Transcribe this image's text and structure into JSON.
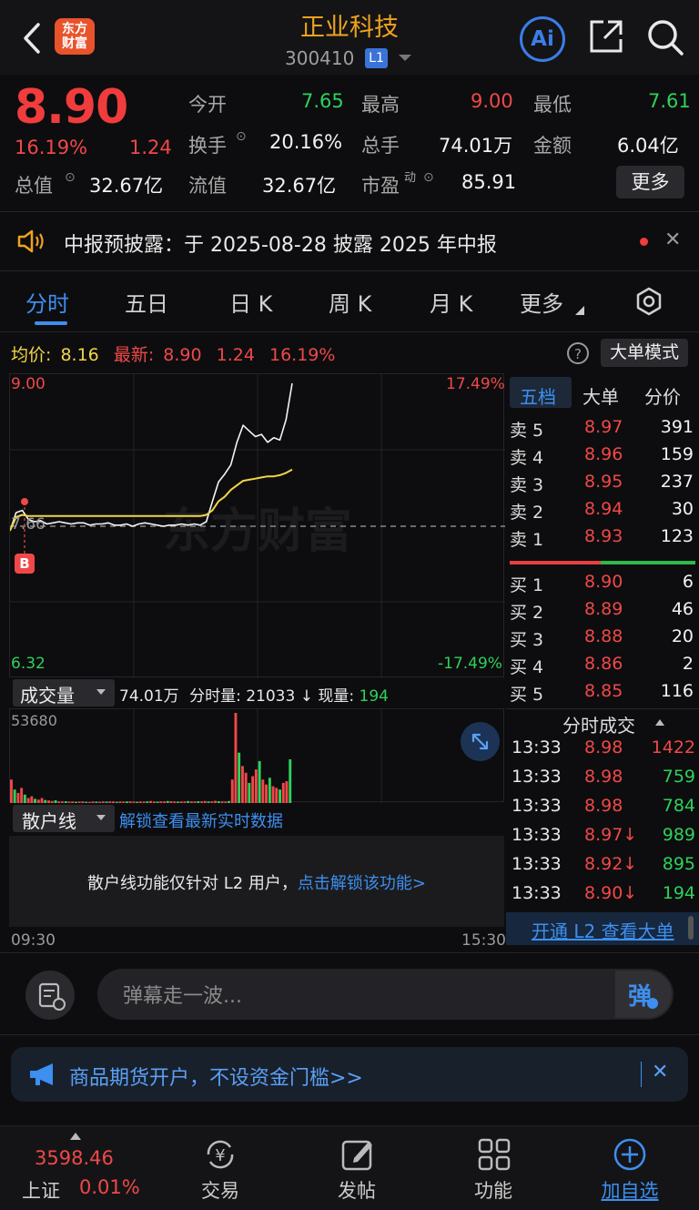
{
  "header": {
    "back_icon": "chevron-left-icon",
    "logo_text_1": "东方",
    "logo_text_2": "财富",
    "title": "正业科技",
    "code": "300410",
    "level_badge": "L1",
    "ai_label": "Ai"
  },
  "quote": {
    "price": "8.90",
    "change_pct": "16.19%",
    "change_amt": "1.24",
    "open_label": "今开",
    "open": "7.65",
    "high_label": "最高",
    "high": "9.00",
    "low_label": "最低",
    "low": "7.61",
    "turnover_label": "换手",
    "turnover": "20.16%",
    "volume_label": "总手",
    "volume": "74.01万",
    "amount_label": "金额",
    "amount": "6.04亿",
    "mktcap_label": "总值",
    "mktcap": "32.67亿",
    "float_label": "流值",
    "float_cap": "32.67亿",
    "pe_label": "市盈",
    "pe_sup": "动",
    "pe": "85.91",
    "more_button": "更多"
  },
  "notice": {
    "text": "中报预披露：于 2025-08-28 披露 2025 年中报"
  },
  "tabs": [
    "分时",
    "五日",
    "日 K",
    "周 K",
    "月 K",
    "更多"
  ],
  "chart_info": {
    "avg_label": "均价:",
    "avg": "8.16",
    "latest_label": "最新:",
    "latest": "8.90",
    "latest_chg": "1.24",
    "latest_pct": "16.19%",
    "mode_button": "大单模式"
  },
  "chart_data": {
    "type": "line",
    "title": "",
    "y_labels": {
      "top": "9.00",
      "mid": "7.66",
      "bottom": "6.32"
    },
    "pct_labels": {
      "top": "17.49%",
      "bottom": "-17.49%"
    },
    "ylim": [
      6.32,
      9.0
    ],
    "baseline": 7.66,
    "x_labels": [
      "09:30",
      "15:30"
    ],
    "marker_label": "B",
    "watermark": "东方财富",
    "series": [
      {
        "values": [
          7.62,
          7.78,
          7.8,
          7.72,
          7.7,
          7.71,
          7.68,
          7.69,
          7.7,
          7.69,
          7.68,
          7.69,
          7.69,
          7.67,
          7.68,
          7.68,
          7.69,
          7.67,
          7.67,
          7.68,
          7.66,
          7.68,
          7.69,
          7.68,
          7.67,
          7.66,
          7.67,
          7.67,
          7.68,
          7.67,
          7.68,
          7.67,
          7.7,
          7.88,
          8.05,
          8.12,
          8.2,
          8.4,
          8.55,
          8.5,
          8.45,
          8.47,
          8.4,
          8.44,
          8.42,
          8.6,
          8.92
        ]
      },
      {
        "values": [
          7.62,
          7.74,
          7.76,
          7.75,
          7.75,
          7.75,
          7.75,
          7.75,
          7.75,
          7.75,
          7.75,
          7.75,
          7.75,
          7.75,
          7.75,
          7.75,
          7.75,
          7.75,
          7.75,
          7.75,
          7.75,
          7.75,
          7.75,
          7.75,
          7.75,
          7.75,
          7.75,
          7.75,
          7.75,
          7.75,
          7.75,
          7.75,
          7.76,
          7.8,
          7.88,
          7.92,
          7.98,
          8.02,
          8.06,
          8.07,
          8.08,
          8.09,
          8.1,
          8.1,
          8.11,
          8.13,
          8.16
        ]
      }
    ]
  },
  "volume": {
    "selector": "成交量",
    "total": "74.01万",
    "period_label": "分时量:",
    "period": "21033",
    "now_label": "现量:",
    "now": "194",
    "max_label": "53680"
  },
  "volume_data": {
    "type": "bar",
    "max": 53680,
    "values": [
      14000,
      8000,
      6000,
      9000,
      5000,
      3000,
      4000,
      2500,
      2000,
      3000,
      1800,
      1500,
      1200,
      1600,
      1000,
      900,
      1100,
      800,
      900,
      700,
      800,
      900,
      700,
      600,
      900,
      800,
      700,
      900,
      800,
      1000,
      900,
      700,
      900,
      800,
      900,
      1000,
      800,
      700,
      900,
      800,
      1000,
      1200,
      900,
      800,
      1000,
      900,
      1200,
      1100,
      900,
      800,
      1000,
      900,
      1200,
      1000,
      900,
      1100,
      1000,
      1200,
      900,
      1000,
      1300,
      1100,
      1000,
      900,
      1200,
      14000,
      53680,
      30000,
      22000,
      18000,
      12000,
      16000,
      20000,
      25000,
      14000,
      11000,
      15000,
      10000,
      9000,
      8000,
      12000,
      13000,
      26000
    ]
  },
  "retail": {
    "selector": "散户线",
    "unlock_link": "解锁查看最新实时数据",
    "panel_text": "散户线功能仅针对 L2 用户，",
    "panel_link": "点击解锁该功能>"
  },
  "orderbook": {
    "tabs": [
      "五档",
      "大单",
      "分价"
    ],
    "asks": [
      {
        "label": "卖 5",
        "price": "8.97",
        "vol": "391"
      },
      {
        "label": "卖 4",
        "price": "8.96",
        "vol": "159"
      },
      {
        "label": "卖 3",
        "price": "8.95",
        "vol": "237"
      },
      {
        "label": "卖 2",
        "price": "8.94",
        "vol": "30"
      },
      {
        "label": "卖 1",
        "price": "8.93",
        "vol": "123"
      }
    ],
    "bids": [
      {
        "label": "买 1",
        "price": "8.90",
        "vol": "6"
      },
      {
        "label": "买 2",
        "price": "8.89",
        "vol": "46"
      },
      {
        "label": "买 3",
        "price": "8.88",
        "vol": "20"
      },
      {
        "label": "买 4",
        "price": "8.86",
        "vol": "2"
      },
      {
        "label": "买 5",
        "price": "8.85",
        "vol": "116"
      }
    ]
  },
  "trades": {
    "title": "分时成交",
    "rows": [
      {
        "time": "13:33",
        "price": "8.98",
        "vol": "1422"
      },
      {
        "time": "13:33",
        "price": "8.98",
        "vol": "759"
      },
      {
        "time": "13:33",
        "price": "8.98",
        "vol": "784"
      },
      {
        "time": "13:33",
        "price": "8.97↓",
        "vol": "989"
      },
      {
        "time": "13:33",
        "price": "8.92↓",
        "vol": "895"
      },
      {
        "time": "13:33",
        "price": "8.90↓",
        "vol": "194"
      }
    ],
    "l2_link": "开通 L2 查看大单"
  },
  "comment": {
    "placeholder": "弹幕走一波...",
    "danmu_button": "弹"
  },
  "banner": {
    "text": "商品期货开户，不设资金门槛>>"
  },
  "bottom_nav": {
    "index_value": "3598.46",
    "index_name": "上证",
    "index_pct": "0.01%",
    "items": [
      "交易",
      "发帖",
      "功能",
      "加自选"
    ]
  },
  "colors": {
    "up": "#f04848",
    "down": "#2fd15a",
    "accent": "#3d8ff0",
    "title": "#f0a21e"
  }
}
